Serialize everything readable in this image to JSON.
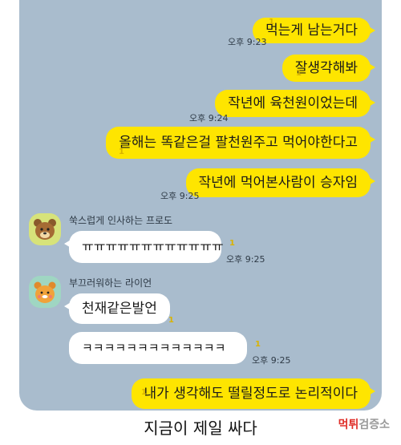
{
  "messages_me": [
    {
      "text": "먹는게 남는거다",
      "time": "오후 9:23",
      "unread": "1"
    },
    {
      "text": "잘생각해봐",
      "time": "",
      "unread": "1"
    },
    {
      "text": "작년에 육천원이었는데",
      "time": "오후 9:24",
      "unread": "1"
    },
    {
      "text": "올해는 똑같은걸 팔천원주고 먹어야한다고",
      "time": "",
      "unread": "1"
    },
    {
      "text": "작년에 먹어본사람이 승자임",
      "time": "오후 9:25",
      "unread": "1"
    },
    {
      "text": "내가 생각해도 떨릴정도로 논리적이다",
      "time": "",
      "unread": "1"
    }
  ],
  "friend1": {
    "name": "쑥스럽게 인사하는 프로도",
    "text": "ㅠㅠㅠㅠㅠㅠㅠㅠㅠㅠㅠㅠ",
    "time": "오후 9:25",
    "unread": "1"
  },
  "friend2": {
    "name": "부끄러워하는 라이언",
    "messages": [
      {
        "text": "천재같은발언",
        "unread": "1"
      },
      {
        "text": "ㅋㅋㅋㅋㅋㅋㅋㅋㅋㅋㅋㅋㅋ",
        "time": "오후 9:25",
        "unread": "1"
      }
    ]
  },
  "caption": "지금이 제일 싸다",
  "watermark": {
    "part1": "먹튀",
    "part2": "검증소"
  },
  "colors": {
    "chat_bg": "#a9bccd",
    "my_bubble": "#fee500",
    "their_bubble": "#ffffff"
  }
}
